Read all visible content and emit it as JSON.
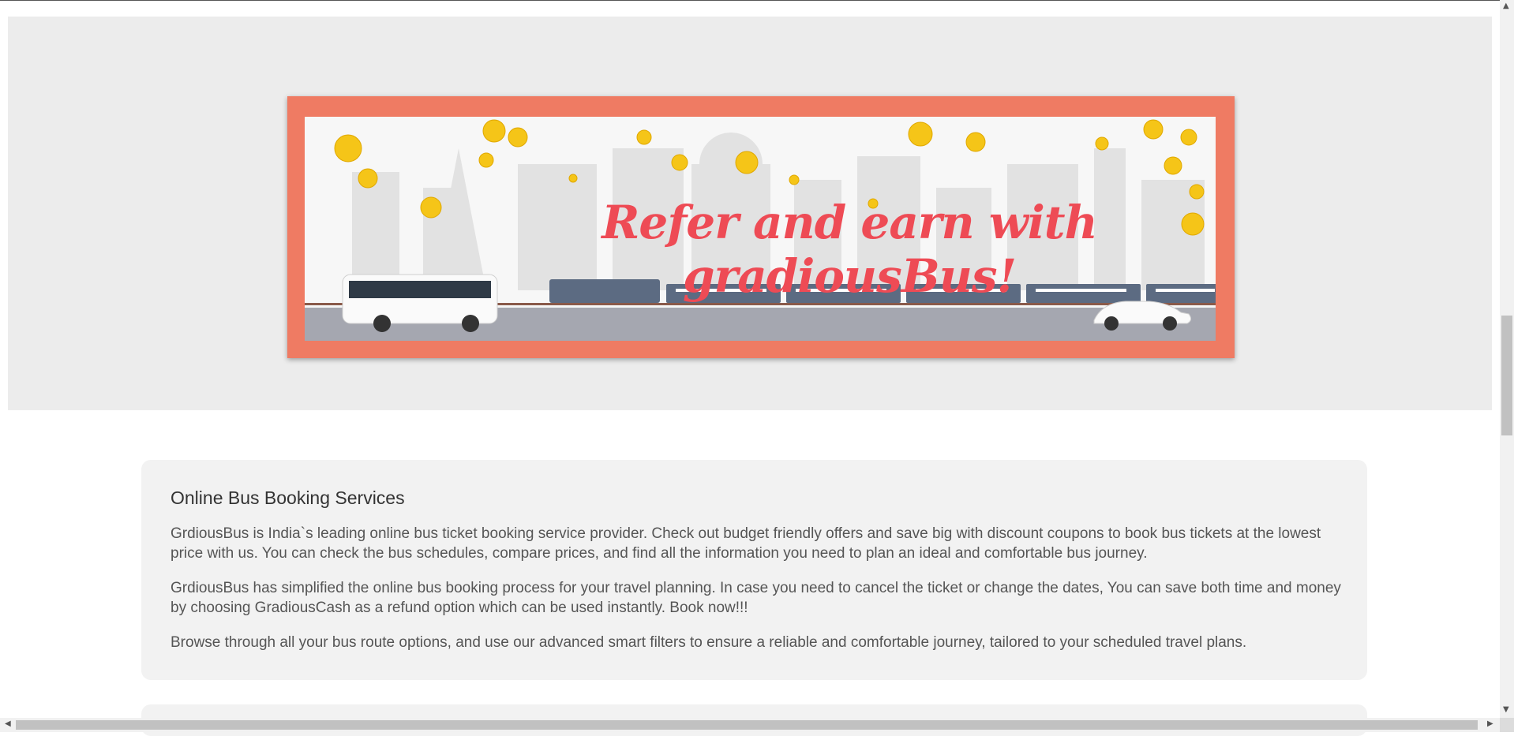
{
  "banner": {
    "title": "Refer and earn with gradiousBus!"
  },
  "info_card": {
    "heading": "Online Bus Booking Services",
    "paragraphs": [
      "GrdiousBus is India`s leading online bus ticket booking service provider. Check out budget friendly offers and save big with discount coupons to book bus tickets at the lowest price with us. You can check the bus schedules, compare prices, and find all the information you need to plan an ideal and comfortable bus journey.",
      "GrdiousBus has simplified the online bus booking process for your travel planning. In case you need to cancel the ticket or change the dates, You can save both time and money by choosing GradiousCash as a refund option which can be used instantly. Book now!!!",
      "Browse through all your bus route options, and use our advanced smart filters to ensure a reliable and comfortable journey, tailored to your scheduled travel plans."
    ]
  },
  "scrollbars": {
    "up_arrow": "▲",
    "down_arrow": "▼",
    "left_arrow": "◀",
    "right_arrow": "▶"
  },
  "colors": {
    "banner_border": "#ef7b63",
    "banner_title": "#ee4b55",
    "coin": "#f5c518",
    "train": "#5c6b82",
    "road": "#a5a7b0"
  }
}
